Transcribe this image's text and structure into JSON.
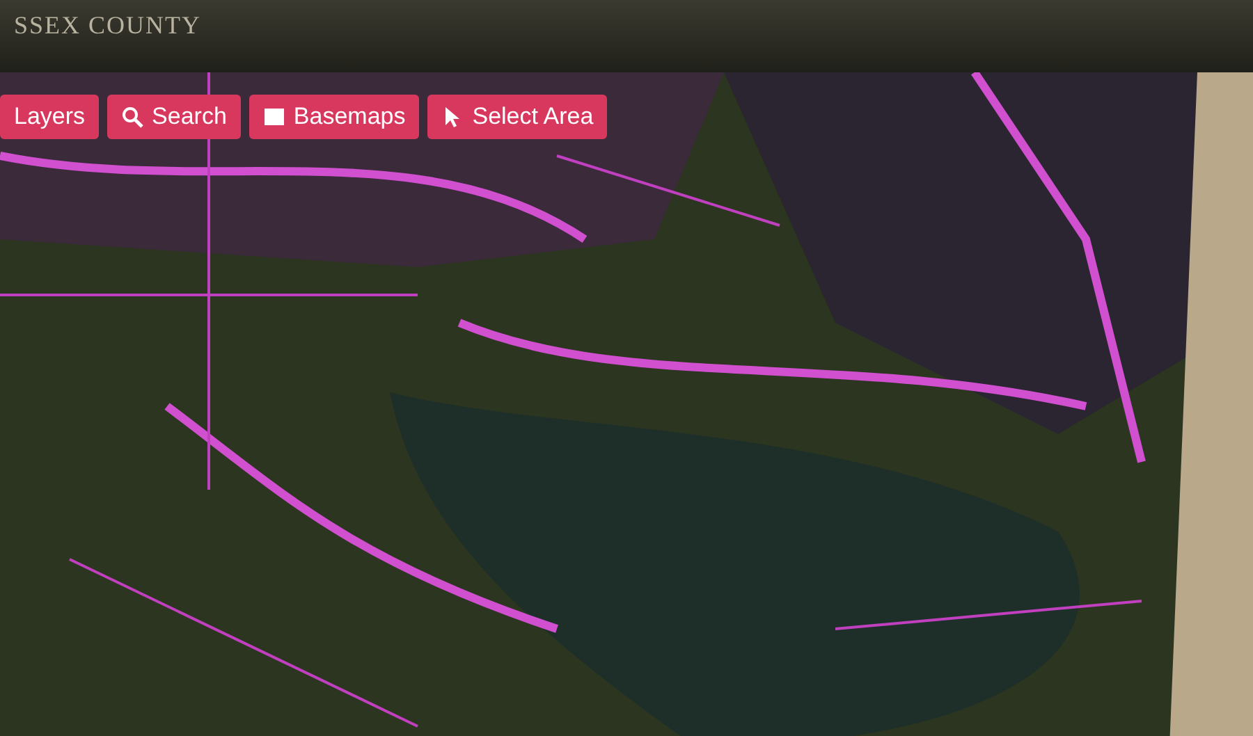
{
  "header": {
    "title": "SSEX COUNTY"
  },
  "toolbar": [
    {
      "label": "Layers"
    },
    {
      "label": "Search"
    },
    {
      "label": "Basemaps"
    },
    {
      "label": "Select Area"
    }
  ]
}
